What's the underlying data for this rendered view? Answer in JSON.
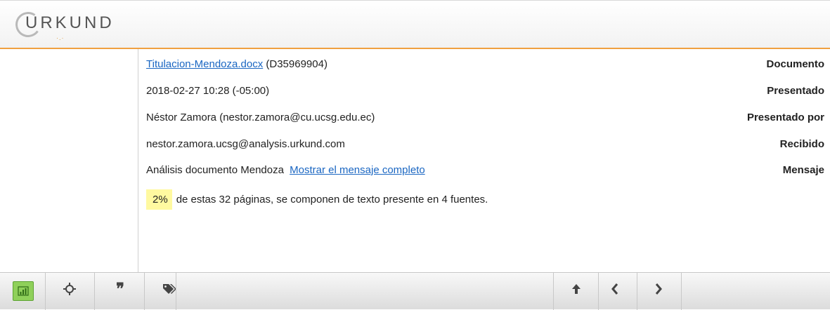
{
  "header": {
    "logo_text": "URKUND"
  },
  "details": {
    "documento_label": "Documento",
    "documento_link": "Titulacion-Mendoza.docx",
    "documento_id": "(D35969904)",
    "presentado_label": "Presentado",
    "presentado_value": "2018-02-27 10:28 (-05:00)",
    "presentado_por_label": "Presentado por",
    "presentado_por_value": "Néstor Zamora (nestor.zamora@cu.ucsg.edu.ec)",
    "recibido_label": "Recibido",
    "recibido_value": "nestor.zamora.ucsg@analysis.urkund.com",
    "mensaje_label": "Mensaje",
    "mensaje_value": "Análisis documento Mendoza",
    "mensaje_link": "Mostrar el mensaje completo",
    "percent": "2%",
    "summary": "de estas 32 páginas, se componen de texto presente en 4 fuentes."
  },
  "toolbar": {
    "buttons": [
      {
        "icon": "bar-chart-icon",
        "active": true
      },
      {
        "icon": "crosshair-icon",
        "active": false
      },
      {
        "icon": "quote-icon",
        "active": false
      },
      {
        "icon": "tags-icon",
        "active": false
      },
      {
        "icon": "arrow-up-icon",
        "active": false
      },
      {
        "icon": "chevron-left-icon",
        "active": false
      },
      {
        "icon": "chevron-right-icon",
        "active": false
      }
    ],
    "accent_color": "#8fd05a"
  },
  "colors": {
    "header_accent": "#f0a040",
    "link": "#1a66c2",
    "highlight": "#fff9a0"
  }
}
